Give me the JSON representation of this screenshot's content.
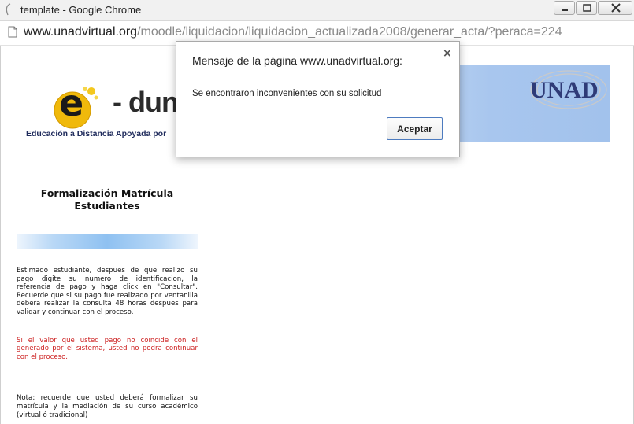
{
  "window": {
    "title": "template - Google Chrome"
  },
  "address_bar": {
    "url_host": "www.unadvirtual.org",
    "url_path": "/moodle/liquidacion/liquidacion_actualizada2008/generar_acta/?peraca=224"
  },
  "banner": {
    "logo_letter": "e",
    "logo_text": "- duna",
    "tagline": "Educación a Distancia Apoyada por",
    "unad_logo_text": "UNAD"
  },
  "sidebar": {
    "title": "Formalización Matrícula Estudiantes",
    "paragraph_1": "Estimado estudiante, despues de que realizo su pago digite su numero de identificacion, la referencia de pago y haga click en \"Consultar\". Recuerde que si su pago fue realizado por ventanilla debera realizar la consulta 48 horas despues para validar y continuar con el proceso.",
    "paragraph_2": "Si el valor que usted pago no coincide con el generado por el sistema, usted no podra continuar con el proceso.",
    "paragraph_3": "Nota: recuerde que usted deberá formalizar su matrícula y la mediación de su curso académico (virtual ó tradicional) ."
  },
  "dialog": {
    "title": "Mensaje de la página www.unadvirtual.org:",
    "close_symbol": "×",
    "message": "Se encontraron inconvenientes con su solicitud",
    "ok_label": "Aceptar"
  },
  "colors": {
    "warning_text": "#cc1f1f",
    "dialog_button_border": "#4d7bbf"
  }
}
